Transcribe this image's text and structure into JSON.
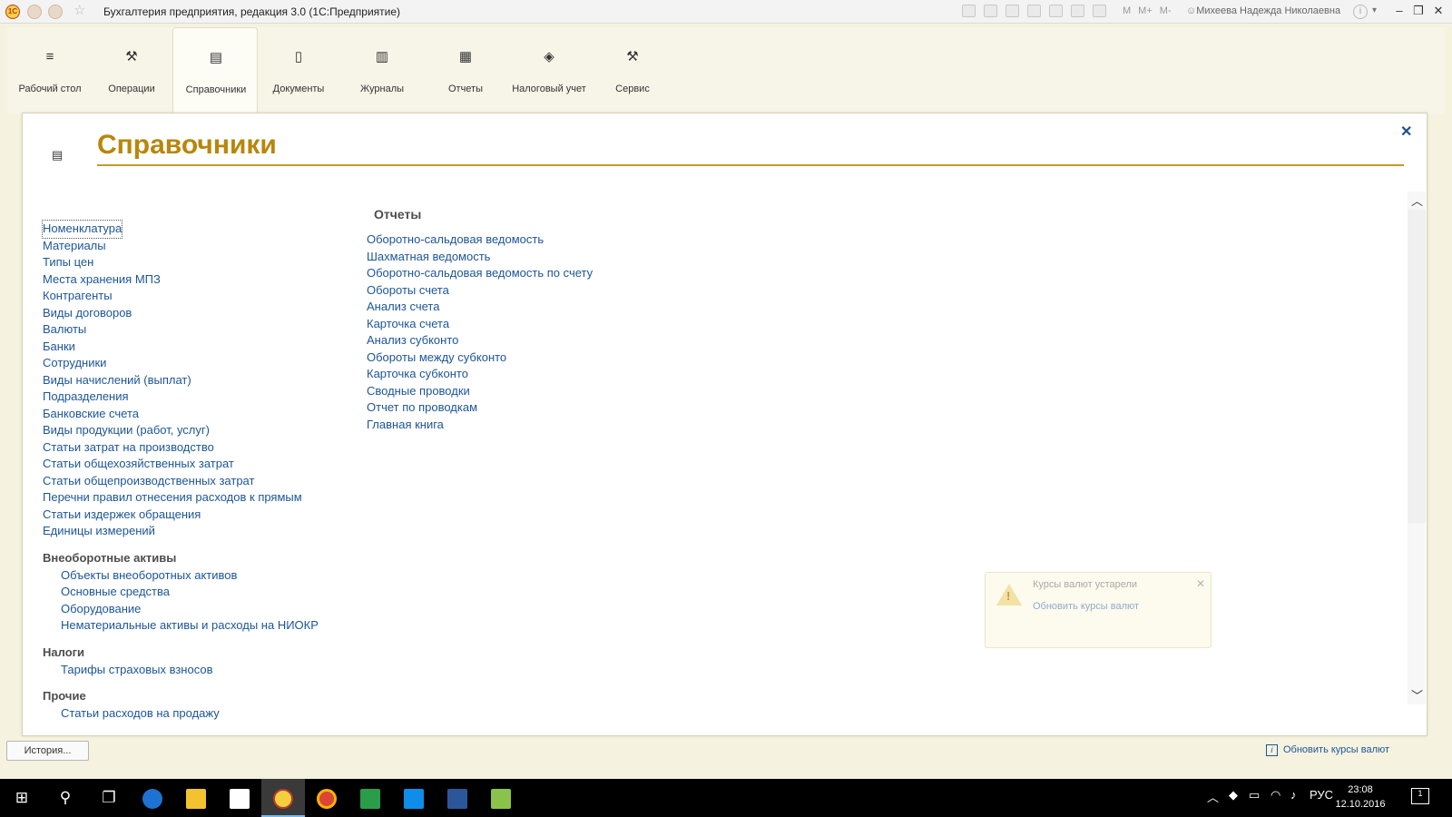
{
  "window": {
    "title": "Бухгалтерия предприятия, редакция 3.0  (1С:Предприятие)",
    "logo": "1С",
    "user": "Михеева Надежда Николаевна",
    "memory_buttons": [
      "M",
      "M+",
      "M-"
    ]
  },
  "nav": [
    {
      "label": "Рабочий стол",
      "icon": "hamburger-menu-icon",
      "active": false
    },
    {
      "label": "Операции",
      "icon": "operations-icon",
      "active": false
    },
    {
      "label": "Справочники",
      "icon": "catalogs-icon",
      "active": true
    },
    {
      "label": "Документы",
      "icon": "documents-icon",
      "active": false
    },
    {
      "label": "Журналы",
      "icon": "journals-icon",
      "active": false
    },
    {
      "label": "Отчеты",
      "icon": "reports-icon",
      "active": false
    },
    {
      "label": "Налоговый учет",
      "icon": "tax-icon",
      "active": false
    },
    {
      "label": "Сервис",
      "icon": "tools-icon",
      "active": false
    }
  ],
  "page": {
    "title": "Справочники",
    "left_links": [
      "Номенклатура",
      "Материалы",
      "Типы цен",
      "Места хранения МПЗ",
      "Контрагенты",
      "Виды договоров",
      "Валюты",
      "Банки",
      "Сотрудники",
      "Виды начислений (выплат)",
      "Подразделения",
      "Банковские счета",
      "Виды продукции (работ, услуг)",
      "Статьи затрат на производство",
      "Статьи общехозяйственных затрат",
      "Статьи общепроизводственных затрат",
      "Перечни правил отнесения расходов к прямым",
      "Статьи издержек обращения",
      "Единицы измерений"
    ],
    "groups": [
      {
        "title": "Внеоборотные активы",
        "items": [
          "Объекты внеоборотных активов",
          "Основные средства",
          "Оборудование",
          "Нематериальные активы и расходы на НИОКР"
        ]
      },
      {
        "title": "Налоги",
        "items": [
          "Тарифы страховых взносов"
        ]
      },
      {
        "title": "Прочие",
        "items": [
          "Статьи расходов на продажу"
        ]
      }
    ],
    "reports_title": "Отчеты",
    "reports": [
      "Оборотно-сальдовая ведомость",
      "Шахматная ведомость",
      "Оборотно-сальдовая ведомость по счету",
      "Обороты счета",
      "Анализ счета",
      "Карточка счета",
      "Анализ субконто",
      "Обороты между субконто",
      "Карточка субконто",
      "Сводные проводки",
      "Отчет по проводкам",
      "Главная книга"
    ]
  },
  "notification": {
    "title": "Курсы валют устарели",
    "link": "Обновить курсы валют"
  },
  "statusbar": {
    "history": "История...",
    "message": "Обновить курсы валют"
  },
  "taskbar": {
    "lang": "РУС",
    "time": "23:08",
    "date": "12.10.2016",
    "notification_count": "1"
  }
}
